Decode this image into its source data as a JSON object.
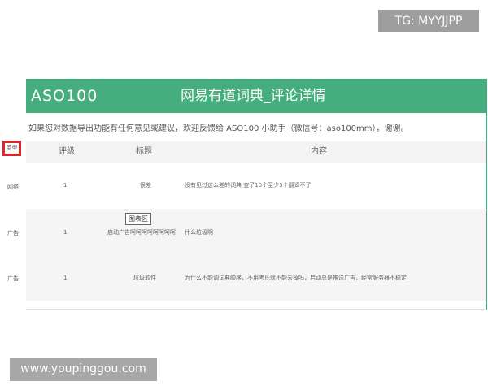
{
  "watermarks": {
    "top_right": "TG: MYYJJPP",
    "bottom_left": "www.youpinggou.com"
  },
  "header": {
    "logo": "ASO100",
    "title": "网易有道词典_评论详情"
  },
  "notice": "如果您对数据导出功能有任何意见或建议，欢迎反馈给 ASO100 小助手（微信号：aso100mm），谢谢。",
  "table": {
    "type_header": "类型",
    "columns": [
      "评级",
      "标题",
      "内容"
    ],
    "rows": [
      {
        "type": "网络",
        "rating": "1",
        "title": "很差",
        "content": "没有见过这么差的词典 查了10个至少3个翻译不了"
      },
      {
        "type": "广告",
        "rating": "1",
        "title": "启动广告呵呵呵呵呵呵呵呵",
        "content": "什么垃圾啊"
      },
      {
        "type": "广告",
        "rating": "1",
        "title": "垃圾软件",
        "content": "为什么不能调词典顺序，不用考氏就不能去掉吗，启动总是推送广告，经常服务器不稳定"
      }
    ]
  },
  "tooltip": "图表区"
}
